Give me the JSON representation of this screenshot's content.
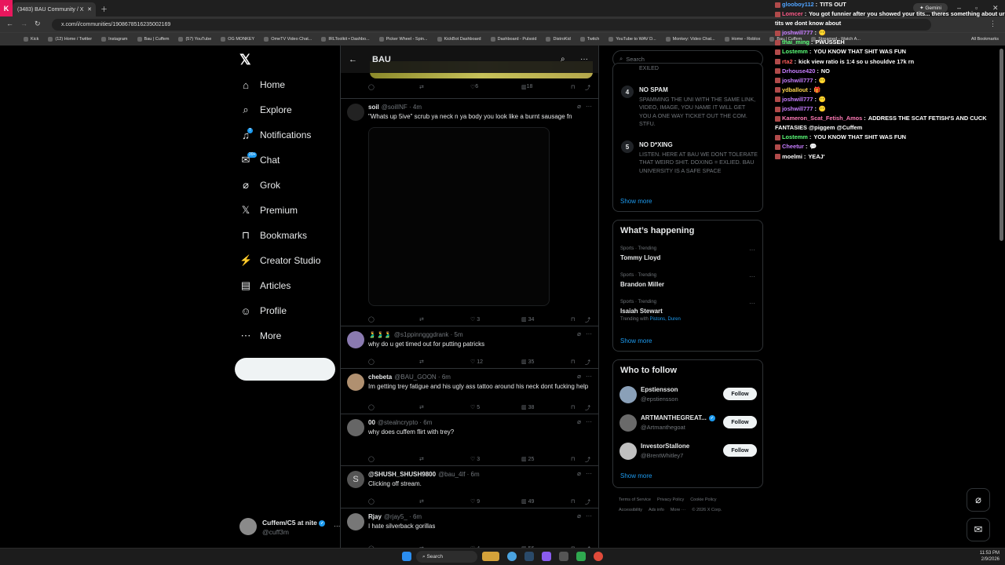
{
  "browser": {
    "active_tab_title": "(3483) BAU Community / X",
    "url": "x.com/i/communities/1908678516235002169",
    "bookmarks": [
      "Kick",
      "(12) Home / Twitter",
      "Instagram",
      "Bau | Cuffem",
      "(57) YouTube",
      "OG MONKEY",
      "OmeTV Video Chat...",
      "IRLToolkit • Dashbo...",
      "Picker Wheel - Spin...",
      "KickBot Dashboard",
      "Dashboard - Pulsoid",
      "DistroKid",
      "Twitch",
      "YouTube to WAV D...",
      "Monkey: Video Chat...",
      "Home - Roblox",
      "Bau | Cuffem",
      "Streamed - Watch A..."
    ],
    "all_bookmarks": "All Bookmarks",
    "gemini_label": "Gemini"
  },
  "nav": {
    "items": [
      {
        "label": "Home",
        "icon": "home-icon"
      },
      {
        "label": "Explore",
        "icon": "search-icon"
      },
      {
        "label": "Notifications",
        "icon": "bell-icon",
        "badge": "7"
      },
      {
        "label": "Chat",
        "icon": "mail-icon",
        "badge": "20+"
      },
      {
        "label": "Grok",
        "icon": "grok-icon"
      },
      {
        "label": "Premium",
        "icon": "x-icon"
      },
      {
        "label": "Bookmarks",
        "icon": "bookmark-icon"
      },
      {
        "label": "Creator Studio",
        "icon": "lightning-icon"
      },
      {
        "label": "Articles",
        "icon": "article-icon"
      },
      {
        "label": "Profile",
        "icon": "person-icon"
      },
      {
        "label": "More",
        "icon": "more-icon"
      }
    ],
    "profile_name": "Cuffem/C5 at nite",
    "profile_handle": "@cuff3m"
  },
  "feed": {
    "title": "BAU",
    "top_actions": {
      "likes": "6",
      "views": "18"
    },
    "posts": [
      {
        "name": "soil",
        "handle": "@soilINF",
        "time": "4m",
        "text": "\"Whats up 5ive\" scrub ya neck n ya body you look like a burnt sausage fn",
        "likes": "3",
        "views": "34"
      },
      {
        "name": "🫃🫃🫃",
        "handle": "@s1ppinngggdrank",
        "time": "5m",
        "text": "why do u get timed out for putting patricks",
        "likes": "12",
        "views": "35"
      },
      {
        "name": "chebeta",
        "handle": "@BAU_GOON",
        "time": "6m",
        "text": "Im getting trey fatigue and his ugly ass tattoo around his neck dont fucking help",
        "likes": "5",
        "views": "38"
      },
      {
        "name": "00",
        "handle": "@stealncrypto",
        "time": "6m",
        "text": "why does cuffem flirt with trey?",
        "likes": "3",
        "views": "25"
      },
      {
        "name": "@SHUSH_SHUSH9800",
        "handle": "@bau_4lf",
        "time": "6m",
        "text": "Clicking off stream.",
        "likes": "9",
        "views": "49",
        "avatar_letter": "S"
      },
      {
        "name": "Rjay",
        "handle": "@rjay5_",
        "time": "6m",
        "text": "I hate silverback gorillas",
        "likes": "4",
        "views": "56"
      }
    ]
  },
  "search": {
    "placeholder": "Search"
  },
  "rules": {
    "partial_top": "EXILED",
    "items": [
      {
        "num": "4",
        "title": "NO SPAM",
        "body": "SPAMMING THE UNI WITH THE SAME LINK, VIDEO, IMAGE, YOU NAME IT WILL GET YOU A ONE WAY TICKET OUT THE COM. STFU."
      },
      {
        "num": "5",
        "title": "NO D*XING",
        "body": "LISTEN. HERE AT BAU WE DONT TOLERATE THAT WEIRD SHIT. DOXING = EXLIED. BAU UNIVERSITY IS A SAFE SPACE"
      }
    ],
    "show_more": "Show more"
  },
  "happening": {
    "title": "What’s happening",
    "trends": [
      {
        "category": "Sports · Trending",
        "name": "Tommy Lloyd"
      },
      {
        "category": "Sports · Trending",
        "name": "Brandon Miller"
      },
      {
        "category": "Sports · Trending",
        "name": "Isaiah Stewart",
        "with_label": "Trending with",
        "with": "Pistons, Duren"
      }
    ],
    "show_more": "Show more"
  },
  "who_to_follow": {
    "title": "Who to follow",
    "users": [
      {
        "name": "Epstiensson",
        "handle": "@epstiensson",
        "verified": false
      },
      {
        "name": "ARTMANTHEGREAT...",
        "handle": "@Artmanthegoat",
        "verified": true
      },
      {
        "name": "InvestorStallone",
        "handle": "@BrentWhitley7",
        "verified": false
      }
    ],
    "follow_label": "Follow",
    "show_more": "Show more"
  },
  "footer": {
    "row1": [
      "Terms of Service",
      "Privacy Policy",
      "Cookie Policy"
    ],
    "row2": [
      "Accessibility",
      "Ads info",
      "More ···",
      "© 2026 X Corp."
    ]
  },
  "chat": [
    {
      "user": "glooboy112",
      "color": "#4fa3ff",
      "text": "TITS OUT"
    },
    {
      "user": "Lomcer",
      "color": "#ff5c8a",
      "text": "You got funnier after you showed your tits... theres something about ur tits we dont know about"
    },
    {
      "user": "joshwill777",
      "color": "#c77dff",
      "text": "😶"
    },
    {
      "user": "thai_ming",
      "color": "#5cff7a",
      "text": "PWUSSEH"
    },
    {
      "user": "Lostemm",
      "color": "#5cff7a",
      "text": "YOU KNOW THAT SHIT WAS FUN"
    },
    {
      "user": "rta2",
      "color": "#ff5c5c",
      "text": "kick view ratio is 1:4 so u shouldve 17k rn"
    },
    {
      "user": "Drhouse420",
      "color": "#c77dff",
      "text": "NO"
    },
    {
      "user": "joshwill777",
      "color": "#c77dff",
      "text": "😶"
    },
    {
      "user": "ydballout",
      "color": "#ffd84f",
      "text": "🎁"
    },
    {
      "user": "joshwill777",
      "color": "#c77dff",
      "text": "😶"
    },
    {
      "user": "joshwill777",
      "color": "#c77dff",
      "text": "😶"
    },
    {
      "user": "Kameron_Scat_Fetish_Amos",
      "color": "#ff7ab6",
      "text": "ADDRESS THE SCAT FETISH'S AND CUCK FANTASIES @piggem @Cuffem"
    },
    {
      "user": "Lostemm",
      "color": "#5cff7a",
      "text": "YOU KNOW THAT SHIT WAS FUN"
    },
    {
      "user": "Cheetur",
      "color": "#c77dff",
      "text": "💬"
    },
    {
      "user": "moelmi",
      "color": "#ffffff",
      "text": "YEAJ'"
    }
  ],
  "taskbar": {
    "search_label": "Search",
    "time": "11:53 PM",
    "date": "2/9/2026"
  }
}
